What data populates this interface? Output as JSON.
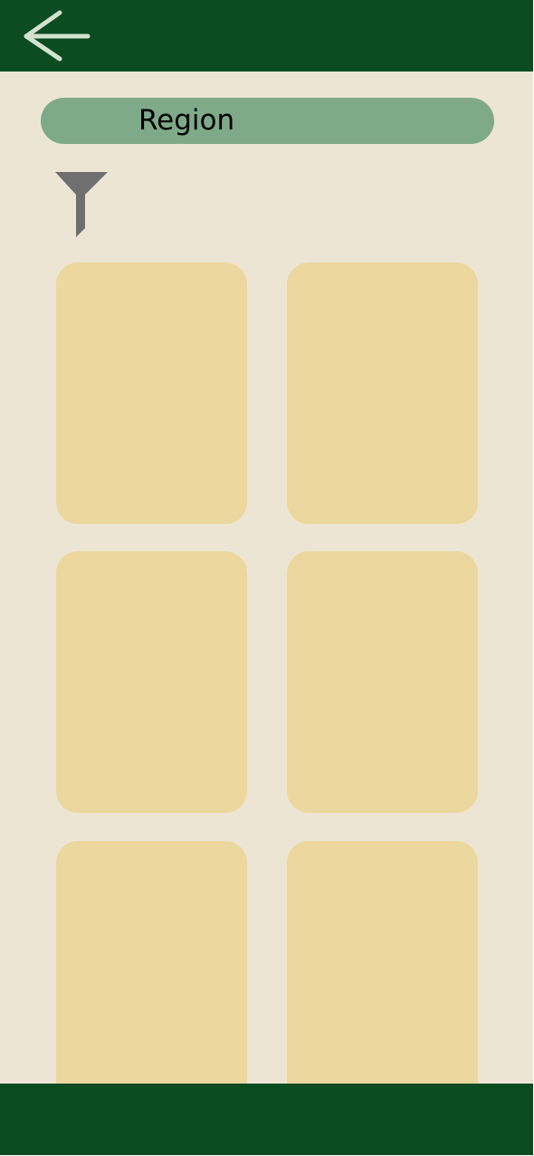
{
  "header": {
    "back_icon": "arrow-left-icon"
  },
  "filter_bar": {
    "region_label": "Region",
    "filter_icon": "funnel-filter-icon"
  },
  "grid": {
    "cards": [
      {
        "id": "card-1"
      },
      {
        "id": "card-2"
      },
      {
        "id": "card-3"
      },
      {
        "id": "card-4"
      },
      {
        "id": "card-5"
      },
      {
        "id": "card-6"
      }
    ]
  },
  "colors": {
    "header_green": "#0B4C21",
    "background_cream": "#EDE5D4",
    "pill_green": "#7FAA8A",
    "card_yellow": "#ECD89E",
    "icon_light": "#D3E2CF",
    "icon_gray": "#6F6F6F"
  }
}
